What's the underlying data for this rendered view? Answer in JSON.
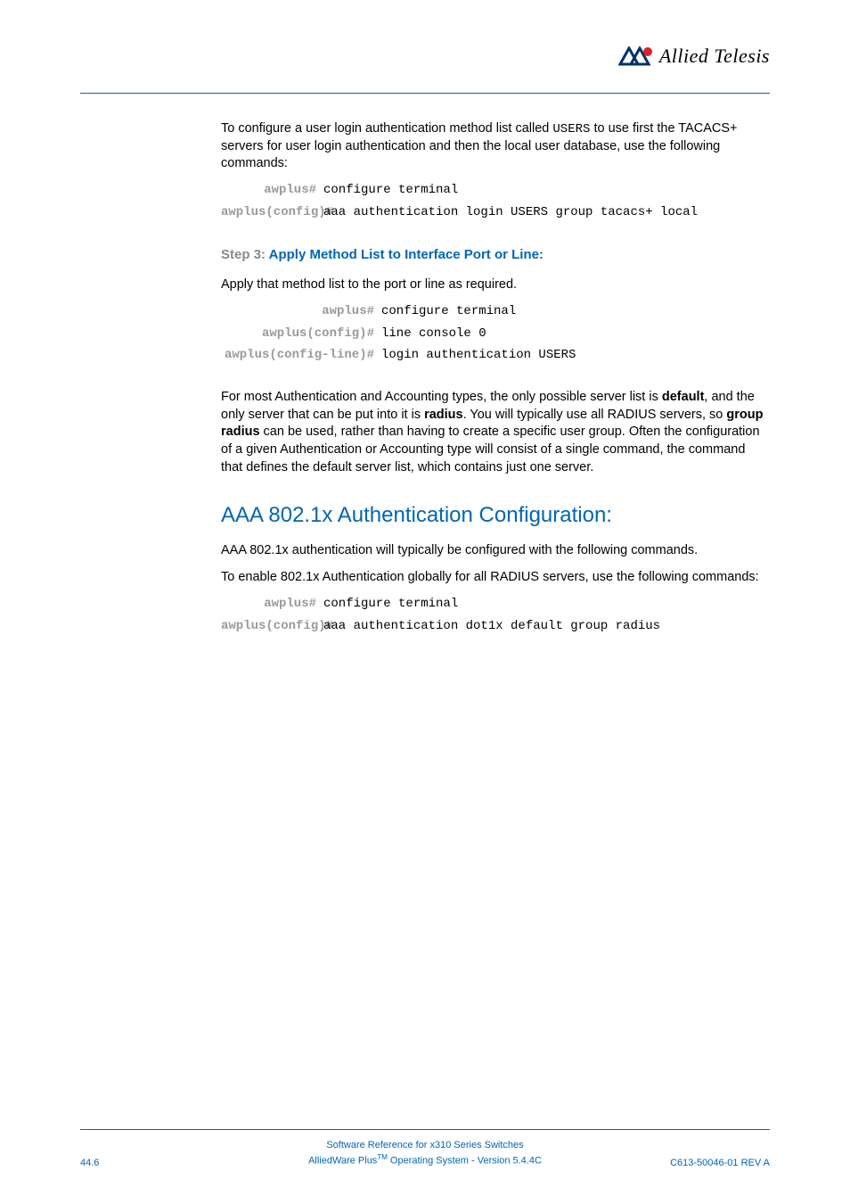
{
  "logo": {
    "text": "Allied Telesis"
  },
  "intro": {
    "p1a": "To configure a user login authentication method list called ",
    "p1_code": "USERS",
    "p1b": " to use first the TACACS+ servers for user login authentication and then the local user database, use the following commands:"
  },
  "cmd1": {
    "r1": {
      "prompt": "awplus#",
      "text": "configure terminal"
    },
    "r2": {
      "prompt": "awplus(config)#",
      "text": "aaa authentication login USERS group tacacs+ local"
    }
  },
  "step3": {
    "label": "Step 3: ",
    "title": "Apply Method List to Interface Port or Line:",
    "p1": "Apply that method list to the port or line as required."
  },
  "cmd2": {
    "r1": {
      "prompt": "awplus#",
      "text": "configure terminal"
    },
    "r2": {
      "prompt": "awplus(config)#",
      "text": "line console 0"
    },
    "r3": {
      "prompt": "awplus(config-line)#",
      "text": "login authentication USERS"
    }
  },
  "para2": {
    "a": "For most Authentication and Accounting types, the only possible server list is ",
    "b1": "default",
    "b": ", and the only server that can be put into it is ",
    "b2": "radius",
    "c": ". You will typically use all RADIUS servers, so ",
    "b3": "group radius",
    "d": " can be used, rather than having to create a specific user group. Often the configuration of a given Authentication or Accounting type will consist of a single command, the command that defines the default server list, which contains just one server."
  },
  "section": {
    "heading": "AAA 802.1x Authentication Configuration:",
    "p1": "AAA 802.1x authentication will typically be configured with the following commands.",
    "p2": "To enable 802.1x Authentication globally for all RADIUS servers, use the following commands:"
  },
  "cmd3": {
    "r1": {
      "prompt": "awplus#",
      "text": "configure terminal"
    },
    "r2": {
      "prompt": "awplus(config)#",
      "text": "aaa authentication dot1x default group radius"
    }
  },
  "footer": {
    "line1": "Software Reference for x310 Series Switches",
    "line2a": "AlliedWare Plus",
    "line2_tm": "TM",
    "line2b": " Operating System  - Version 5.4.4C",
    "page": "44.6",
    "rev": "C613-50046-01 REV A"
  }
}
